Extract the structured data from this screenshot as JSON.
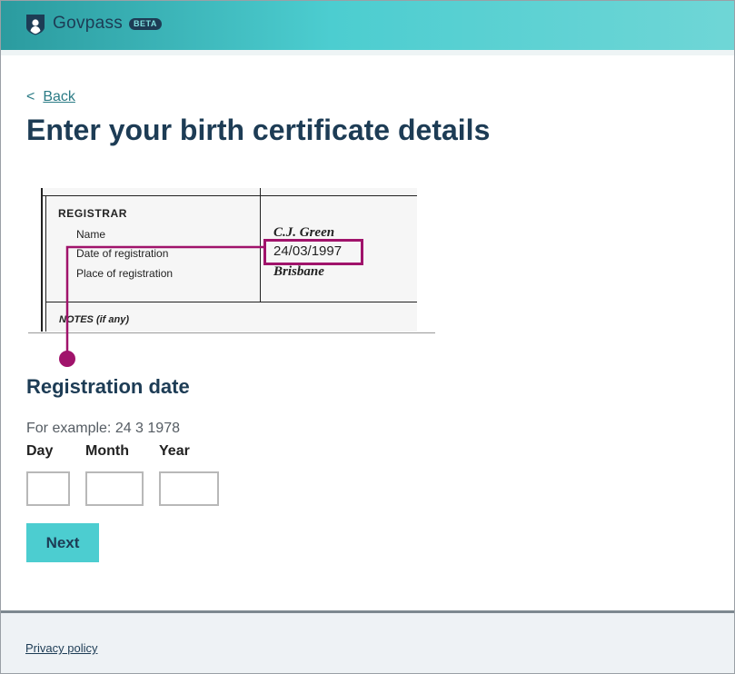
{
  "header": {
    "brand": "Govpass",
    "badge": "BETA",
    "icon": "shield-icon",
    "colors": {
      "gradient_start": "#2b9b9f",
      "gradient_end": "#6fd6d6",
      "brand_text": "#1d3c55"
    }
  },
  "nav": {
    "back_chevron": "<",
    "back_label": "Back"
  },
  "page": {
    "title": "Enter your birth certificate details"
  },
  "certificate": {
    "section_label": "REGISTRAR",
    "rows": [
      {
        "label": "Name",
        "value": "C.J. Green"
      },
      {
        "label": "Date of registration",
        "value": "24/03/1997"
      },
      {
        "label": "Place of registration",
        "value": "Brisbane"
      }
    ],
    "notes_label": "NOTES (if any)",
    "highlight_color": "#a0136b"
  },
  "form": {
    "heading": "Registration date",
    "hint": "For example: 24 3 1978",
    "fields": {
      "day": {
        "label": "Day",
        "value": ""
      },
      "month": {
        "label": "Month",
        "value": ""
      },
      "year": {
        "label": "Year",
        "value": ""
      }
    },
    "submit_label": "Next",
    "accent": "#4ccdd0"
  },
  "footer": {
    "privacy_label": "Privacy policy"
  }
}
